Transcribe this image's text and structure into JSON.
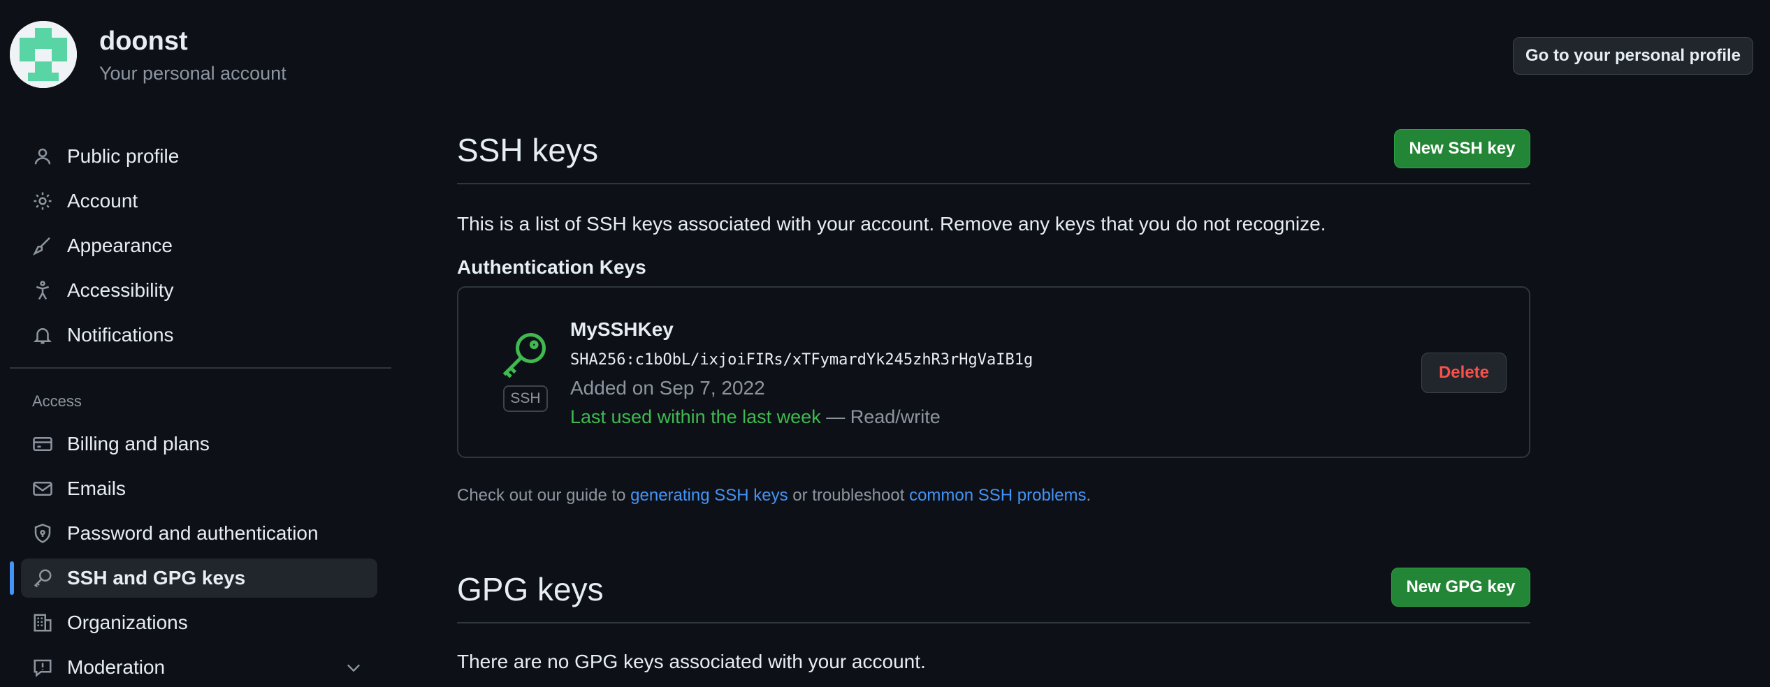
{
  "header": {
    "username": "doonst",
    "subtitle": "Your personal account",
    "profile_button": "Go to your personal profile"
  },
  "sidebar": {
    "items": [
      {
        "label": "Public profile",
        "icon": "person-icon"
      },
      {
        "label": "Account",
        "icon": "gear-icon"
      },
      {
        "label": "Appearance",
        "icon": "paintbrush-icon"
      },
      {
        "label": "Accessibility",
        "icon": "accessibility-icon"
      },
      {
        "label": "Notifications",
        "icon": "bell-icon"
      }
    ],
    "section_access": "Access",
    "access_items": [
      {
        "label": "Billing and plans",
        "icon": "credit-card-icon"
      },
      {
        "label": "Emails",
        "icon": "mail-icon"
      },
      {
        "label": "Password and authentication",
        "icon": "shield-lock-icon"
      },
      {
        "label": "SSH and GPG keys",
        "icon": "key-icon",
        "active": true
      },
      {
        "label": "Organizations",
        "icon": "organization-icon"
      },
      {
        "label": "Moderation",
        "icon": "report-icon"
      }
    ]
  },
  "ssh": {
    "title": "SSH keys",
    "new_button": "New SSH key",
    "description": "This is a list of SSH keys associated with your account. Remove any keys that you do not recognize.",
    "auth_heading": "Authentication Keys",
    "key": {
      "name": "MySSHKey",
      "fingerprint": "SHA256:c1bObL/ixjoiFIRs/xTFymardYk245zhR3rHgVaIB1g",
      "added": "Added on Sep 7, 2022",
      "last_used": "Last used within the last week",
      "access": "— Read/write",
      "badge": "SSH",
      "delete_button": "Delete"
    },
    "guide": {
      "prefix": "Check out our guide to ",
      "link1": "generating SSH keys",
      "middle": " or troubleshoot ",
      "link2": "common SSH problems",
      "suffix": "."
    }
  },
  "gpg": {
    "title": "GPG keys",
    "new_button": "New GPG key",
    "empty_text": "There are no GPG keys associated with your account."
  },
  "colors": {
    "background": "#0d1117",
    "accent_blue": "#4493f8",
    "button_green": "#238636",
    "success_green": "#3fb950",
    "danger_red": "#f85149",
    "avatar_green": "#59d4a4"
  }
}
